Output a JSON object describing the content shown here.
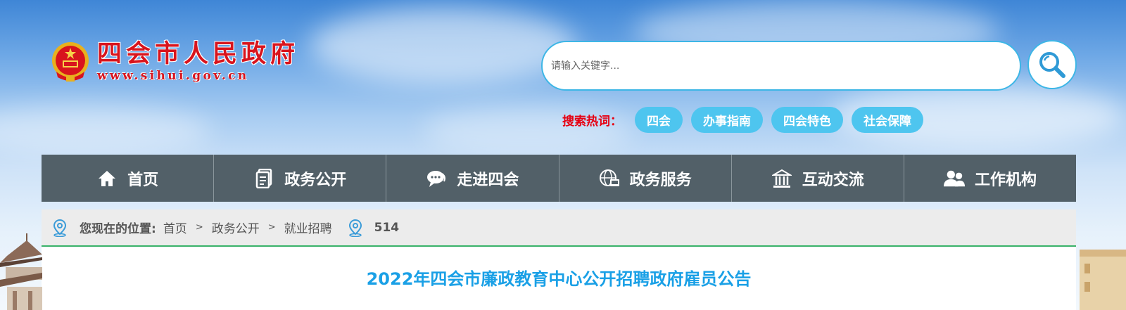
{
  "header": {
    "site_title": "四会市人民政府",
    "site_url": "www.sihui.gov.cn"
  },
  "search": {
    "placeholder": "请输入关键字...",
    "button_icon": "search-icon"
  },
  "hot_words": {
    "label": "搜索热词：",
    "tags": [
      "四会",
      "办事指南",
      "四会特色",
      "社会保障"
    ]
  },
  "nav": {
    "items": [
      {
        "label": "首页",
        "icon": "home-icon"
      },
      {
        "label": "政务公开",
        "icon": "document-icon"
      },
      {
        "label": "走进四会",
        "icon": "chat-bubble-icon"
      },
      {
        "label": "政务服务",
        "icon": "globe-service-icon"
      },
      {
        "label": "互动交流",
        "icon": "building-icon"
      },
      {
        "label": "工作机构",
        "icon": "users-icon"
      }
    ]
  },
  "breadcrumb": {
    "label": "您现在的位置:",
    "items": [
      "首页",
      "政务公开",
      "就业招聘"
    ],
    "separator": ">",
    "visit_count": "514"
  },
  "article": {
    "title": "2022年四会市廉政教育中心公开招聘政府雇员公告"
  },
  "colors": {
    "title_red": "#d8141d",
    "accent_blue": "#3db6e6",
    "tag_blue": "#4ec5ef",
    "nav_bg": "#526068",
    "hot_label_red": "#e60012",
    "article_title_blue": "#1aa0e6",
    "breadcrumb_border_green": "#3bb36a"
  }
}
